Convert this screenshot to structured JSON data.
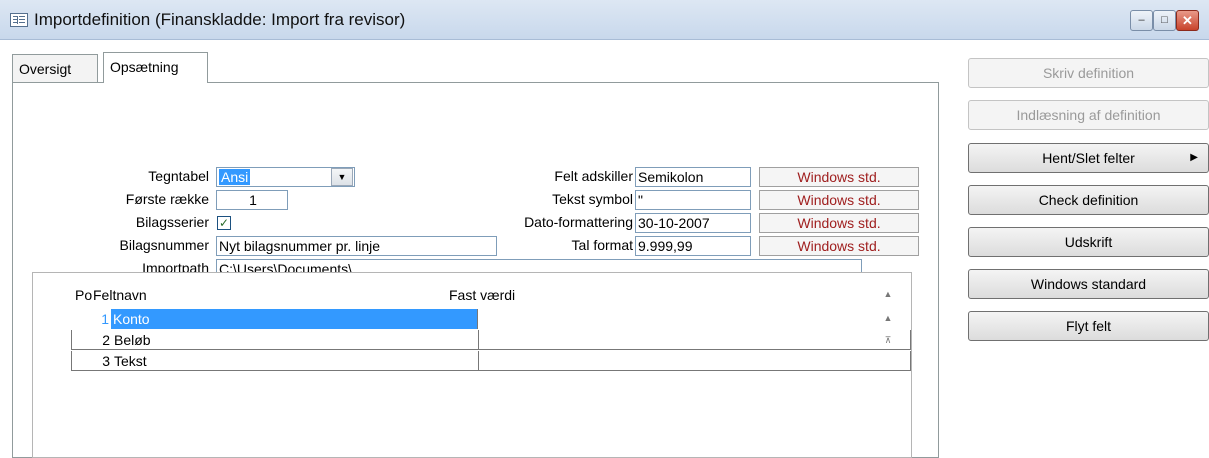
{
  "window": {
    "title": "Importdefinition (Finanskladde: Import fra revisor)",
    "controls": {
      "minimize": "–",
      "maximize": "□",
      "close": "✕"
    }
  },
  "tabs": [
    {
      "label": "Oversigt"
    },
    {
      "label": "Opsætning"
    }
  ],
  "form": {
    "tegntabel_label": "Tegntabel",
    "tegntabel_value": "Ansi",
    "forste_raekke_label": "Første række",
    "forste_raekke_value": "1",
    "bilagsserier_label": "Bilagsserier",
    "bilagsserier_checked": "✓",
    "bilagsnummer_label": "Bilagsnummer",
    "bilagsnummer_value": "Nyt bilagsnummer pr. linje",
    "importpath_label": "Importpath",
    "importpath_value": "C:\\Users\\Documents\\",
    "felt_adskiller_label": "Felt adskiller",
    "felt_adskiller_value": "Semikolon",
    "tekst_symbol_label": "Tekst symbol",
    "tekst_symbol_value": "\"",
    "dato_label": "Dato-formattering",
    "dato_value": "30-10-2007",
    "tal_label": "Tal format",
    "tal_value": "9.999,99",
    "windows_std": "Windows std."
  },
  "grid": {
    "headers": {
      "po": "Po",
      "feltnavn": "Feltnavn",
      "fast_vaerdi": "Fast værdi"
    },
    "rows": [
      {
        "po": "1",
        "feltnavn": "Konto",
        "fast": ""
      },
      {
        "po": "2",
        "feltnavn": "Beløb",
        "fast": ""
      },
      {
        "po": "3",
        "feltnavn": "Tekst",
        "fast": ""
      }
    ]
  },
  "buttons": {
    "skriv": "Skriv definition",
    "indlaesning": "Indlæsning af definition",
    "hent": "Hent/Slet felter",
    "check": "Check definition",
    "udskrift": "Udskrift",
    "windows_standard": "Windows standard",
    "flyt": "Flyt felt"
  },
  "colors": {
    "accent": "#3399ff",
    "windows_std_text": "#a02020",
    "disabled_text": "#9a9a9a"
  }
}
